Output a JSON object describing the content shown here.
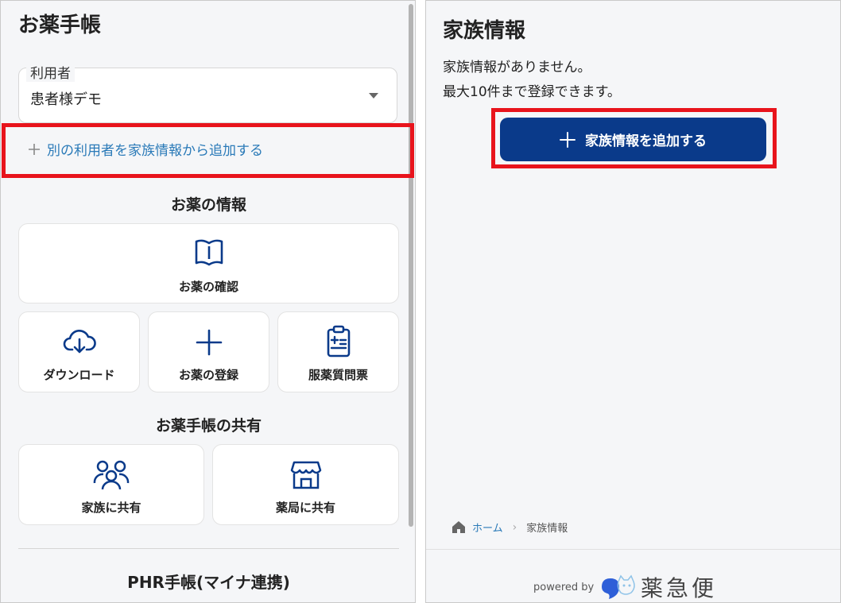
{
  "left": {
    "title": "お薬手帳",
    "user": {
      "legend": "利用者",
      "value": "患者様デモ"
    },
    "add_family_link": "別の利用者を家族情報から追加する",
    "medicine_section": {
      "title": "お薬の情報",
      "confirm": "お薬の確認",
      "download": "ダウンロード",
      "register": "お薬の登録",
      "questionnaire": "服薬質問票"
    },
    "share_section": {
      "title": "お薬手帳の共有",
      "family": "家族に共有",
      "pharmacy": "薬局に共有"
    },
    "phr_title": "PHR手帳(マイナ連携)"
  },
  "right": {
    "title": "家族情報",
    "message_line1": "家族情報がありません。",
    "message_line2": "最大10件まで登録できます。",
    "add_button": "家族情報を追加する",
    "breadcrumb": {
      "home": "ホーム",
      "current": "家族情報"
    },
    "powered_by": "powered by",
    "logo_text": "薬急便"
  },
  "colors": {
    "accent_blue": "#0a3a8a",
    "link_blue": "#2a7ab8",
    "highlight_red": "#e8141c",
    "background": "#f5f6f8"
  },
  "icons": [
    "plus-icon",
    "book-icon",
    "cloud-download-icon",
    "clipboard-icon",
    "people-icon",
    "store-icon",
    "home-icon",
    "chevron-right-icon",
    "caret-down-icon",
    "logo-mark-icon"
  ]
}
